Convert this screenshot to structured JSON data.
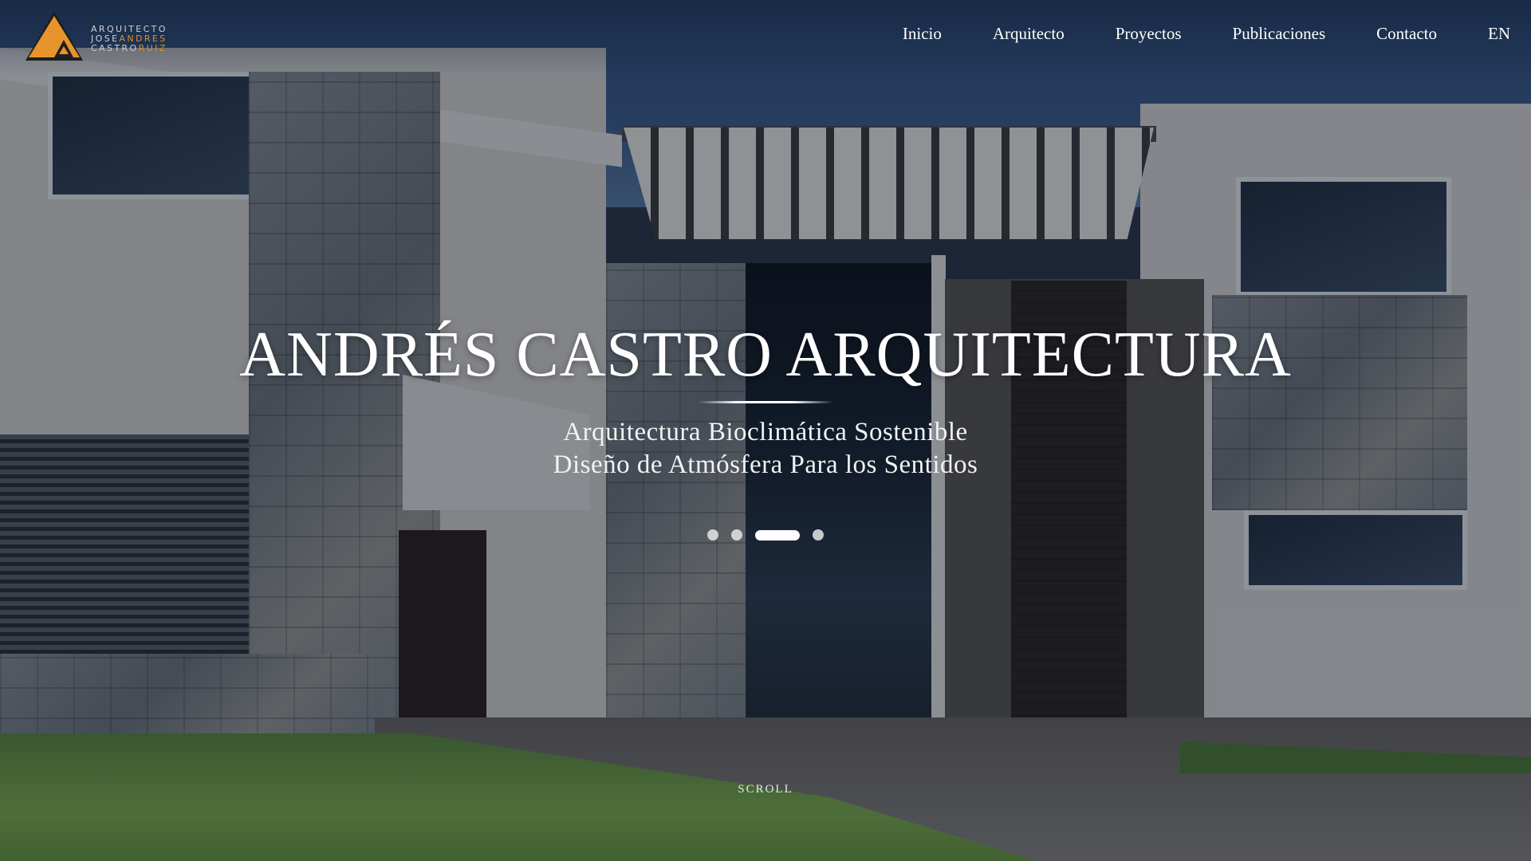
{
  "brand": {
    "line1": "ARQUITECTO",
    "line2_a": "JOSE",
    "line2_b": "ANDRES",
    "line3_a": "CASTRO",
    "line3_b": "RUIZ",
    "logo_color": "#e08e28"
  },
  "nav": {
    "items": [
      "Inicio",
      "Arquitecto",
      "Proyectos",
      "Publicaciones",
      "Contacto"
    ],
    "language": "EN"
  },
  "hero": {
    "title": "ANDRÉS CASTRO ARQUITECTURA",
    "subtitle_line1": "Arquitectura Bioclimática Sostenible",
    "subtitle_line2": "Diseño de Atmósfera Para los Sentidos",
    "slides_total": 4,
    "active_slide": 3,
    "scroll_label": "SCROLL"
  }
}
